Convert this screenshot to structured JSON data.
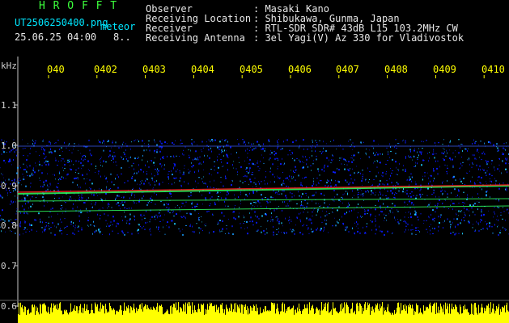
{
  "header": {
    "app_title": "H R O F F T",
    "filename": "UT2506250400.png",
    "mode": "meteor",
    "datetime": "25.06.25 04:00",
    "count": "8.."
  },
  "info": {
    "rows": [
      {
        "label": "Observer",
        "value": ": Masaki Kano"
      },
      {
        "label": "Receiving Location",
        "value": ": Shibukawa, Gunma, Japan"
      },
      {
        "label": "Receiver",
        "value": ": RTL-SDR SDR# 43dB L15 103.2MHz CW"
      },
      {
        "label": "Receiving Antenna",
        "value": ": 3el Yagi(V) Az 330 for Vladivostok"
      }
    ]
  },
  "axes": {
    "y_unit": "kHz",
    "y_ticks": [
      "1.1",
      "1.0",
      "0.9",
      "0.8",
      "0.7",
      "0.6"
    ],
    "time_ticks": [
      "040",
      "0402",
      "0403",
      "0404",
      "0405",
      "0406",
      "0407",
      "0408",
      "0409",
      "0410"
    ]
  },
  "colors": {
    "background": "#000000",
    "title": "#3cff3c",
    "filename": "#00e6ff",
    "ticks": "#ffff00",
    "noise_floor": "#ffff00",
    "signal_strong": "#ff2020",
    "signal_mid": "#30ff60",
    "noise_low": "#0a1cff"
  }
}
